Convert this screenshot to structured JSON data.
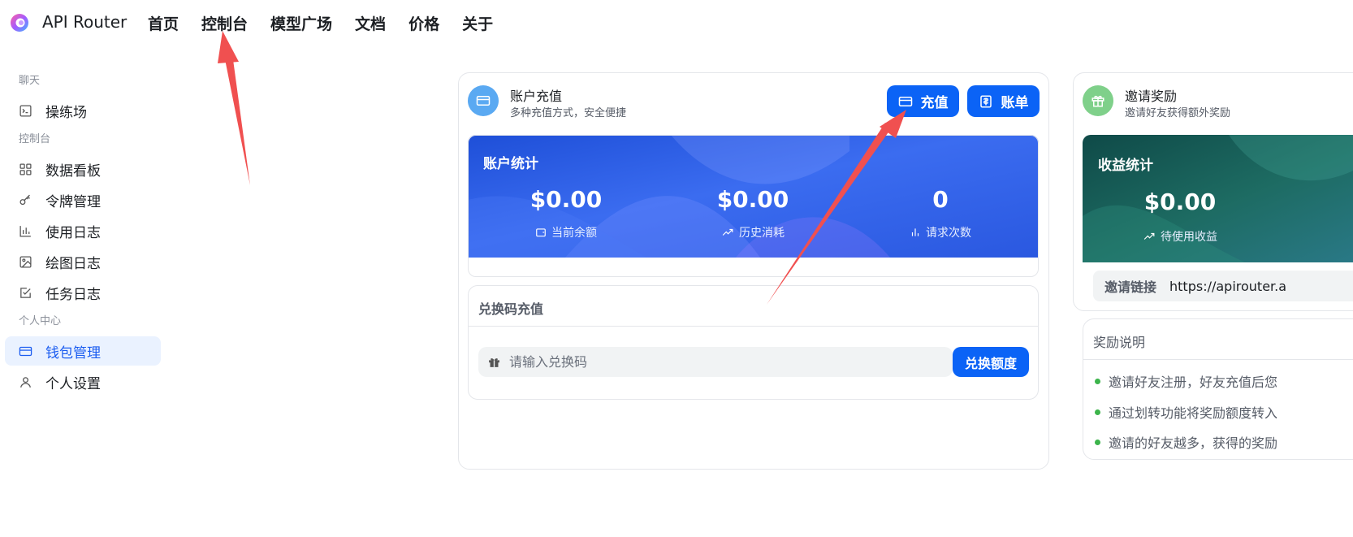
{
  "app": {
    "brand": "API Router"
  },
  "nav": [
    "首页",
    "控制台",
    "模型广场",
    "文档",
    "价格",
    "关于"
  ],
  "sidebar": {
    "groups": [
      {
        "label": "聊天",
        "items": [
          {
            "label": "操练场",
            "icon": "terminal-icon"
          }
        ]
      },
      {
        "label": "控制台",
        "items": [
          {
            "label": "数据看板",
            "icon": "dashboard-icon"
          },
          {
            "label": "令牌管理",
            "icon": "key-icon"
          },
          {
            "label": "使用日志",
            "icon": "bar-chart-icon"
          },
          {
            "label": "绘图日志",
            "icon": "image-icon"
          },
          {
            "label": "任务日志",
            "icon": "checkbox-icon"
          }
        ]
      },
      {
        "label": "个人中心",
        "items": [
          {
            "label": "钱包管理",
            "icon": "wallet-icon",
            "active": true
          },
          {
            "label": "个人设置",
            "icon": "user-icon"
          }
        ]
      }
    ]
  },
  "recharge_card": {
    "title": "账户充值",
    "subtitle": "多种充值方式，安全便捷",
    "recharge_button": "充值",
    "bill_button": "账单",
    "stats": {
      "title": "账户统计",
      "items": [
        {
          "value": "$0.00",
          "label": "当前余额",
          "icon": "wallet-icon"
        },
        {
          "value": "$0.00",
          "label": "历史消耗",
          "icon": "trend-up-icon"
        },
        {
          "value": "0",
          "label": "请求次数",
          "icon": "bar-chart-icon"
        }
      ]
    },
    "redeem": {
      "title": "兑换码充值",
      "placeholder": "请输入兑换码",
      "button": "兑换额度"
    }
  },
  "invite_card": {
    "title": "邀请奖励",
    "subtitle": "邀请好友获得额外奖励",
    "stats_title": "收益统计",
    "pending_value": "$0.00",
    "pending_label": "待使用收益",
    "link_label": "邀请链接",
    "link_value": "https://apirouter.a",
    "rules_title": "奖励说明",
    "rules": [
      "邀请好友注册，好友充值后您",
      "通过划转功能将奖励额度转入",
      "邀请的好友越多，获得的奖励"
    ]
  },
  "colors": {
    "accent": "#0b63f6",
    "active_bg": "#eaf2ff",
    "arrow": "#f05050",
    "bullet": "#3cb44b"
  }
}
